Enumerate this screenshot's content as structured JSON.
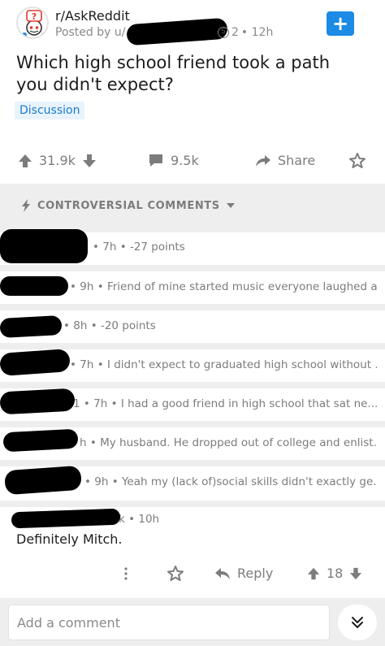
{
  "post": {
    "subreddit": "r/AskReddit",
    "posted_by": "Posted by u/",
    "award_count": "2",
    "age": "• 12h",
    "title": "Which high school friend took a path you didn't expect?",
    "flair": "Discussion"
  },
  "actions": {
    "upvotes": "31.9k",
    "comments": "9.5k",
    "share": "Share"
  },
  "sort": {
    "label": "CONTROVERSIAL COMMENTS"
  },
  "comments": [
    {
      "meta": "• 7h • -27 points"
    },
    {
      "meta": "• 9h • Friend of mine started music everyone laughed a..."
    },
    {
      "meta": "• 8h • -20 points"
    },
    {
      "meta": "• 7h • I didn't expect to graduated high school without ..."
    },
    {
      "meta": "1 • 7h • I had a good friend in high school that sat ne..."
    },
    {
      "meta": "h • My husband. He dropped out of college and enlist..."
    },
    {
      "meta": "• 9h • Yeah my (lack of)social skills didn't exactly ge..."
    },
    {
      "meta": "k • 10h",
      "body": "Definitely Mitch."
    }
  ],
  "expanded_comment_actions": {
    "reply": "Reply",
    "score": "18"
  },
  "compose": {
    "placeholder": "Add a comment"
  },
  "colors": {
    "accent_blue": "#1b8be6",
    "flair_bg": "#e8f3fb",
    "flair_text": "#1b7bd1",
    "muted_text": "#7c7c7c",
    "band_gray": "#eeeeee"
  }
}
